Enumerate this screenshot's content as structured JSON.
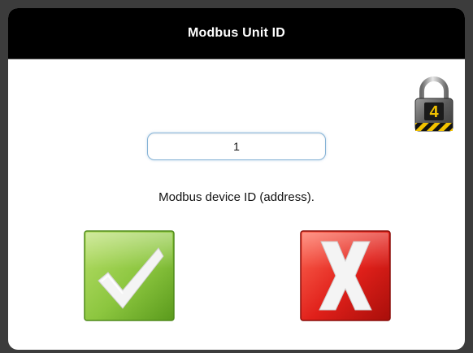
{
  "dialog": {
    "title": "Modbus Unit ID",
    "field_value": "1",
    "description": "Modbus device ID (address).",
    "lock_level": "4"
  },
  "icons": {
    "lock": "padlock-icon",
    "ok": "checkmark-icon",
    "cancel": "x-icon"
  },
  "colors": {
    "title_bar": "#000000",
    "ok_green": "#8cc63f",
    "cancel_red": "#e0201a",
    "field_border": "#86b3d6"
  }
}
